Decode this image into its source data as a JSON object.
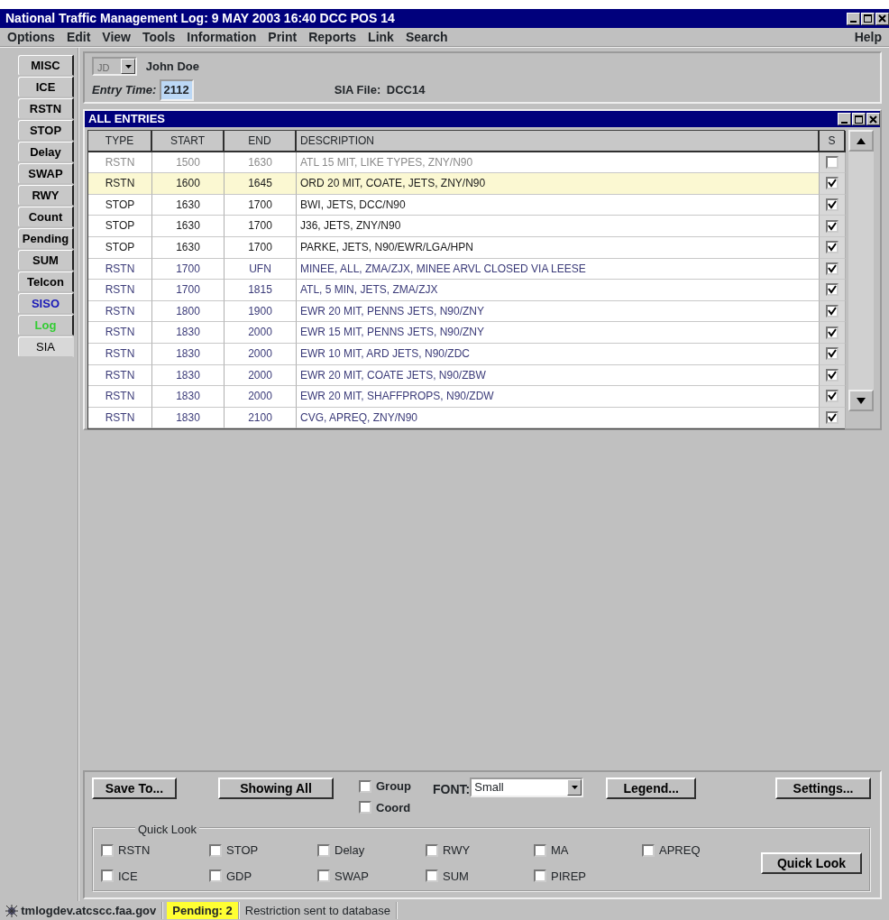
{
  "window": {
    "title": "National Traffic Management Log: 9 MAY 2003  16:40  DCC POS 14"
  },
  "menu": [
    {
      "label": "Options"
    },
    {
      "label": "Edit"
    },
    {
      "label": "View"
    },
    {
      "label": "Tools"
    },
    {
      "label": "Information"
    },
    {
      "label": "Print"
    },
    {
      "label": "Reports"
    },
    {
      "label": "Link"
    },
    {
      "label": "Search"
    }
  ],
  "help_menu": "Help",
  "sidebar_tabs": [
    {
      "label": "MISC",
      "selected": false,
      "color": "#000000"
    },
    {
      "label": "ICE",
      "selected": false,
      "color": "#000000"
    },
    {
      "label": "RSTN",
      "selected": false,
      "color": "#000000"
    },
    {
      "label": "STOP",
      "selected": false,
      "color": "#000000"
    },
    {
      "label": "Delay",
      "selected": false,
      "color": "#000000"
    },
    {
      "label": "SWAP",
      "selected": false,
      "color": "#000000"
    },
    {
      "label": "RWY",
      "selected": false,
      "color": "#000000"
    },
    {
      "label": "Count",
      "selected": false,
      "color": "#000000"
    },
    {
      "label": "Pending",
      "selected": false,
      "color": "#000000"
    },
    {
      "label": "SUM",
      "selected": false,
      "color": "#000000"
    },
    {
      "label": "Telcon",
      "selected": false,
      "color": "#000000"
    },
    {
      "label": "SISO",
      "selected": false,
      "color": "#1a1ab8"
    },
    {
      "label": "Log",
      "selected": false,
      "color": "#33cc33"
    },
    {
      "label": "SIA",
      "selected": true,
      "color": "#000000"
    }
  ],
  "user": {
    "initials": "JD",
    "name": "John Doe"
  },
  "entry_time": {
    "label": "Entry Time:",
    "value": "2112"
  },
  "sia_file": {
    "label": "SIA File:",
    "value": "DCC14"
  },
  "entries_window": {
    "title": "ALL ENTRIES"
  },
  "table": {
    "columns": [
      "TYPE",
      "START",
      "END",
      "DESCRIPTION",
      "S"
    ],
    "rows": [
      {
        "type": "RSTN",
        "start": "1500",
        "end": "1630",
        "description": "ATL 15 MIT, LIKE TYPES, ZNY/N90",
        "checked": false,
        "selected": false,
        "color": "#8a8a8a"
      },
      {
        "type": "RSTN",
        "start": "1600",
        "end": "1645",
        "description": "ORD 20 MIT, COATE, JETS, ZNY/N90",
        "checked": true,
        "selected": true,
        "color": "#1a1a1a"
      },
      {
        "type": "STOP",
        "start": "1630",
        "end": "1700",
        "description": "BWI, JETS, DCC/N90",
        "checked": true,
        "selected": false,
        "color": "#1a1a1a"
      },
      {
        "type": "STOP",
        "start": "1630",
        "end": "1700",
        "description": "J36, JETS, ZNY/N90",
        "checked": true,
        "selected": false,
        "color": "#1a1a1a"
      },
      {
        "type": "STOP",
        "start": "1630",
        "end": "1700",
        "description": "PARKE, JETS, N90/EWR/LGA/HPN",
        "checked": true,
        "selected": false,
        "color": "#1a1a1a"
      },
      {
        "type": "RSTN",
        "start": "1700",
        "end": "UFN",
        "description": "MINEE, ALL, ZMA/ZJX, MINEE ARVL CLOSED VIA LEESE",
        "checked": true,
        "selected": false,
        "color": "#3a3a78"
      },
      {
        "type": "RSTN",
        "start": "1700",
        "end": "1815",
        "description": "ATL, 5 MIN, JETS, ZMA/ZJX",
        "checked": true,
        "selected": false,
        "color": "#3a3a78"
      },
      {
        "type": "RSTN",
        "start": "1800",
        "end": "1900",
        "description": "EWR 20 MIT, PENNS JETS, N90/ZNY",
        "checked": true,
        "selected": false,
        "color": "#3a3a78"
      },
      {
        "type": "RSTN",
        "start": "1830",
        "end": "2000",
        "description": "EWR 15 MIT, PENNS JETS, N90/ZNY",
        "checked": true,
        "selected": false,
        "color": "#3a3a78"
      },
      {
        "type": "RSTN",
        "start": "1830",
        "end": "2000",
        "description": "EWR 10 MIT, ARD JETS, N90/ZDC",
        "checked": true,
        "selected": false,
        "color": "#3a3a78"
      },
      {
        "type": "RSTN",
        "start": "1830",
        "end": "2000",
        "description": "EWR 20 MIT, COATE JETS, N90/ZBW",
        "checked": true,
        "selected": false,
        "color": "#3a3a78"
      },
      {
        "type": "RSTN",
        "start": "1830",
        "end": "2000",
        "description": "EWR 20 MIT, SHAFFPROPS, N90/ZDW",
        "checked": true,
        "selected": false,
        "color": "#3a3a78"
      },
      {
        "type": "RSTN",
        "start": "1830",
        "end": "2100",
        "description": "CVG, APREQ, ZNY/N90",
        "checked": true,
        "selected": false,
        "color": "#3a3a78"
      }
    ]
  },
  "toolbar": {
    "save_button": "Save To...",
    "showing_button": "Showing All",
    "options": [
      {
        "label": "Group",
        "checked": false
      },
      {
        "label": "Coord",
        "checked": false
      }
    ],
    "font_label": "FONT:",
    "font_value": "Small",
    "legend_button": "Legend...",
    "settings_button": "Settings..."
  },
  "quick_look": {
    "title": "Quick Look",
    "items": [
      {
        "label": "RSTN",
        "checked": false
      },
      {
        "label": "STOP",
        "checked": false
      },
      {
        "label": "Delay",
        "checked": false
      },
      {
        "label": "RWY",
        "checked": false
      },
      {
        "label": "MA",
        "checked": false
      },
      {
        "label": "APREQ",
        "checked": false
      },
      {
        "label": "ICE",
        "checked": false
      },
      {
        "label": "GDP",
        "checked": false
      },
      {
        "label": "SWAP",
        "checked": false
      },
      {
        "label": "SUM",
        "checked": false
      },
      {
        "label": "PIREP",
        "checked": false
      }
    ],
    "button": "Quick Look"
  },
  "status_bar": {
    "host": "tmlogdev.atcscc.faa.gov",
    "pending": "Pending:  2",
    "message": "Restriction sent to database"
  }
}
